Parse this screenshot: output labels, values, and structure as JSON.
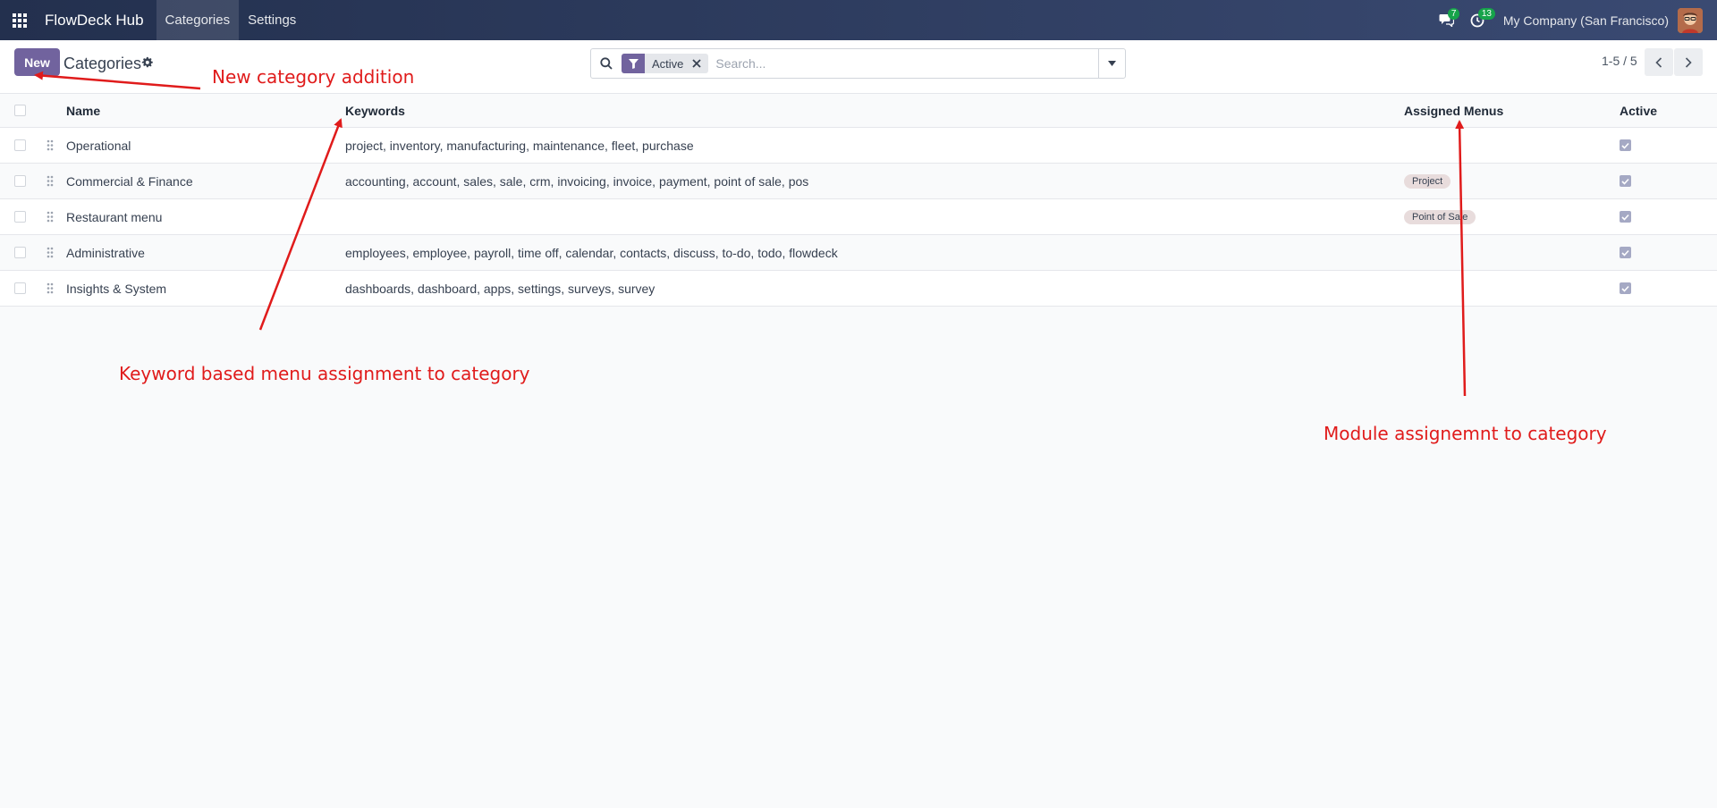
{
  "navbar": {
    "brand": "FlowDeck Hub",
    "menus": [
      "Categories",
      "Settings"
    ],
    "messages_badge": "7",
    "activity_badge": "13",
    "company": "My Company (San Francisco)"
  },
  "control_panel": {
    "new_label": "New",
    "title": "Categories",
    "search": {
      "facet_label": "Active",
      "placeholder": "Search..."
    },
    "pager": "1-5 / 5"
  },
  "list": {
    "columns": [
      "Name",
      "Keywords",
      "Assigned Menus",
      "Active"
    ],
    "rows": [
      {
        "name": "Operational",
        "keywords": "project, inventory, manufacturing, maintenance, fleet, purchase",
        "menu": "",
        "active": true
      },
      {
        "name": "Commercial & Finance",
        "keywords": "accounting, account, sales, sale, crm, invoicing, invoice, payment, point of sale, pos",
        "menu": "Project",
        "active": true
      },
      {
        "name": "Restaurant menu",
        "keywords": "",
        "menu": "Point of Sale",
        "active": true
      },
      {
        "name": "Administrative",
        "keywords": "employees, employee, payroll, time off, calendar, contacts, discuss, to-do, todo, flowdeck",
        "menu": "",
        "active": true
      },
      {
        "name": "Insights & System",
        "keywords": "dashboards, dashboard, apps, settings, surveys, survey",
        "menu": "",
        "active": true
      }
    ]
  },
  "annotations": {
    "new_category": "New category addition",
    "keyword": "Keyword based menu assignment to category",
    "module": "Module assignemnt to category"
  },
  "colors": {
    "primary": "#71639e",
    "navbar": "#23304e",
    "annotation": "#e01b1b",
    "badge": "#16a34a"
  }
}
